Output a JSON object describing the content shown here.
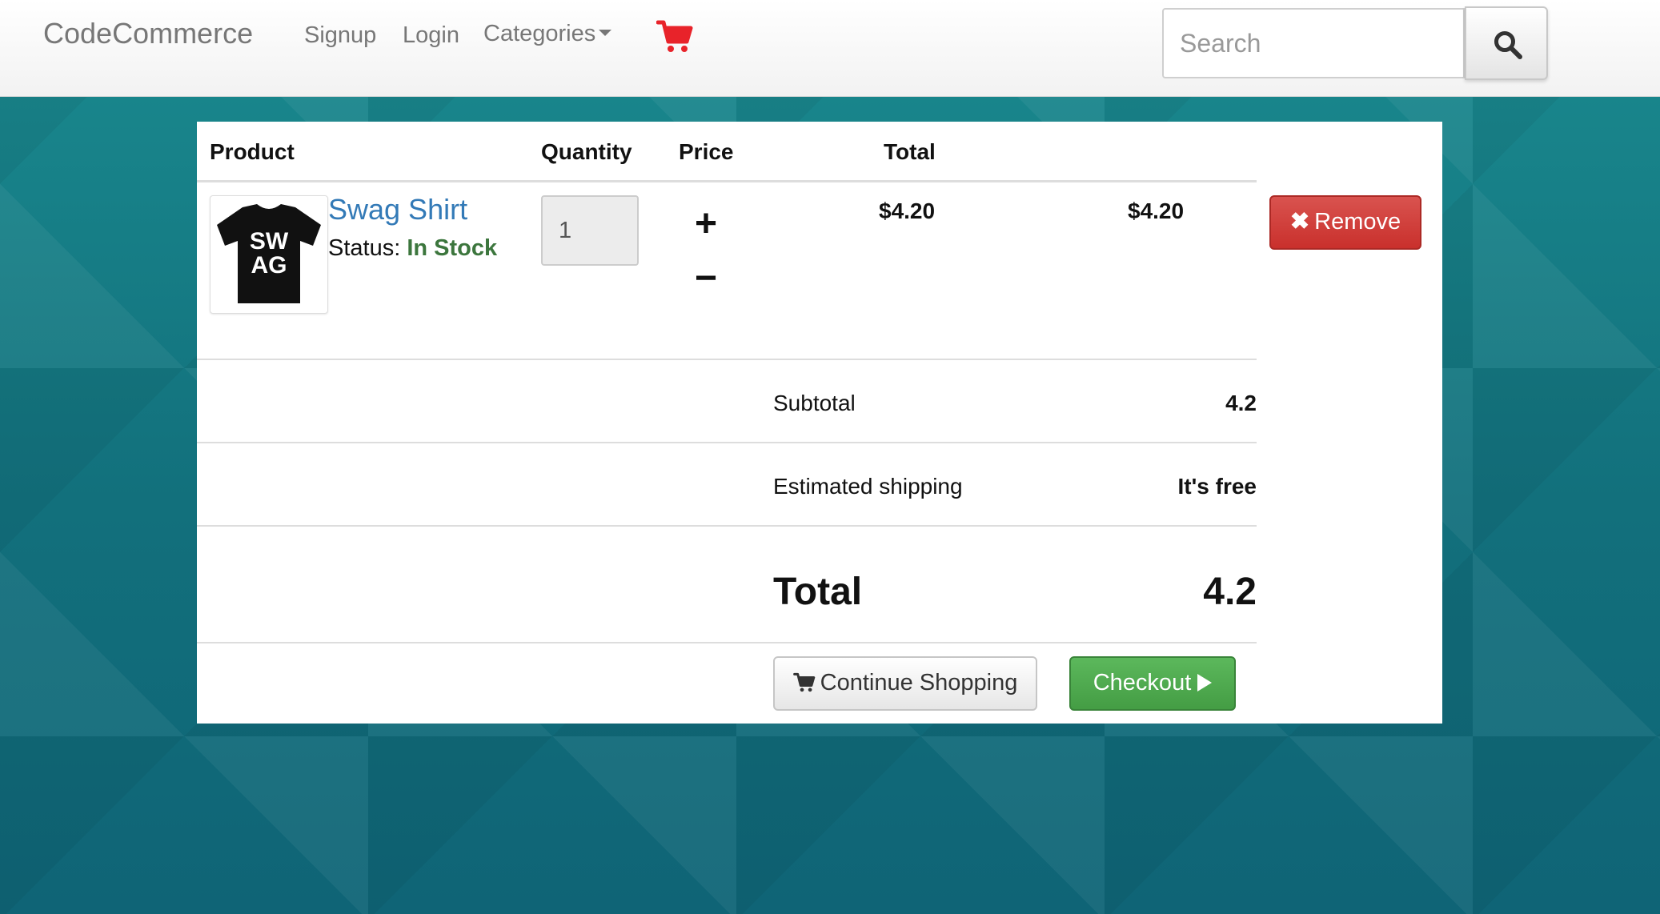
{
  "navbar": {
    "brand": "CodeCommerce",
    "links": {
      "signup": "Signup",
      "login": "Login",
      "categories": "Categories"
    },
    "cart_icon": "shopping-cart-icon",
    "cart_icon_color": "#e8232a",
    "search": {
      "placeholder": "Search",
      "value": "",
      "button_icon": "search-icon"
    }
  },
  "cart": {
    "headers": {
      "product": "Product",
      "quantity": "Quantity",
      "price": "Price",
      "total": "Total"
    },
    "items": [
      {
        "name": "Swag Shirt",
        "status_label": "Status:",
        "status_value": "In Stock",
        "image_text": "SWAG",
        "quantity": "1",
        "increment_label": "+",
        "decrement_label": "−",
        "price": "$4.20",
        "line_total": "$4.20",
        "remove_label": "Remove",
        "remove_icon": "close-icon"
      }
    ],
    "summary": {
      "subtotal_label": "Subtotal",
      "subtotal_value": "4.2",
      "shipping_label": "Estimated shipping",
      "shipping_value": "It's free",
      "total_label": "Total",
      "total_value": "4.2"
    },
    "actions": {
      "continue_label": "Continue Shopping",
      "continue_icon": "shopping-cart-icon",
      "checkout_label": "Checkout",
      "checkout_icon": "play-icon"
    }
  },
  "colors": {
    "link_blue": "#337ab7",
    "stock_green": "#3c763d",
    "remove_red": "#d9534f",
    "checkout_green": "#5cb85c",
    "background_teal": "#15707e"
  }
}
